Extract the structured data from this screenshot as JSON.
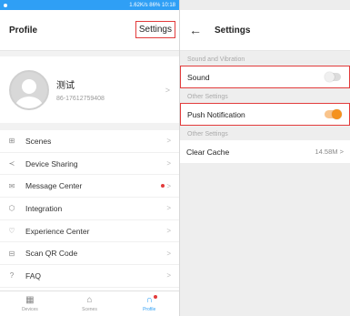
{
  "left": {
    "status_bar": {
      "network_speed": "1.62K/s",
      "battery": "86%",
      "time": "10:18"
    },
    "header": {
      "title": "Profile",
      "settings_link": "Settings"
    },
    "profile": {
      "name": "测试",
      "phone": "86-17612759408"
    },
    "menu": [
      {
        "label": "Scenes",
        "icon": "scenes-icon",
        "glyph": "⊞"
      },
      {
        "label": "Device Sharing",
        "icon": "share-icon",
        "glyph": "≺"
      },
      {
        "label": "Message Center",
        "icon": "message-icon",
        "glyph": "✉",
        "unread": true
      },
      {
        "label": "Integration",
        "icon": "cube-icon",
        "glyph": "⬡"
      },
      {
        "label": "Experience Center",
        "icon": "heart-icon",
        "glyph": "♡"
      },
      {
        "label": "Scan QR Code",
        "icon": "scan-icon",
        "glyph": "⊟"
      },
      {
        "label": "FAQ",
        "icon": "question-icon",
        "glyph": "?"
      },
      {
        "label": "Feedback",
        "icon": "feedback-icon",
        "glyph": "▭"
      }
    ],
    "tabbar": [
      {
        "label": "Devices",
        "icon": "grid-icon",
        "glyph": "▦"
      },
      {
        "label": "Scenes",
        "icon": "home-icon",
        "glyph": "⌂"
      },
      {
        "label": "Profile",
        "icon": "profile-icon",
        "glyph": "∩",
        "active": true
      }
    ]
  },
  "right": {
    "header": {
      "title": "Settings"
    },
    "sections": {
      "sound_vibration": "Sound and Vibration",
      "other1": "Other Settings",
      "other2": "Other Settings"
    },
    "sound": {
      "label": "Sound",
      "enabled": false
    },
    "push": {
      "label": "Push Notification",
      "enabled": true
    },
    "cache": {
      "label": "Clear Cache",
      "value": "14.58M"
    }
  },
  "colors": {
    "accent_blue": "#2f9ff5",
    "toggle_orange": "#f5921e",
    "highlight_red": "#e23b3b"
  }
}
